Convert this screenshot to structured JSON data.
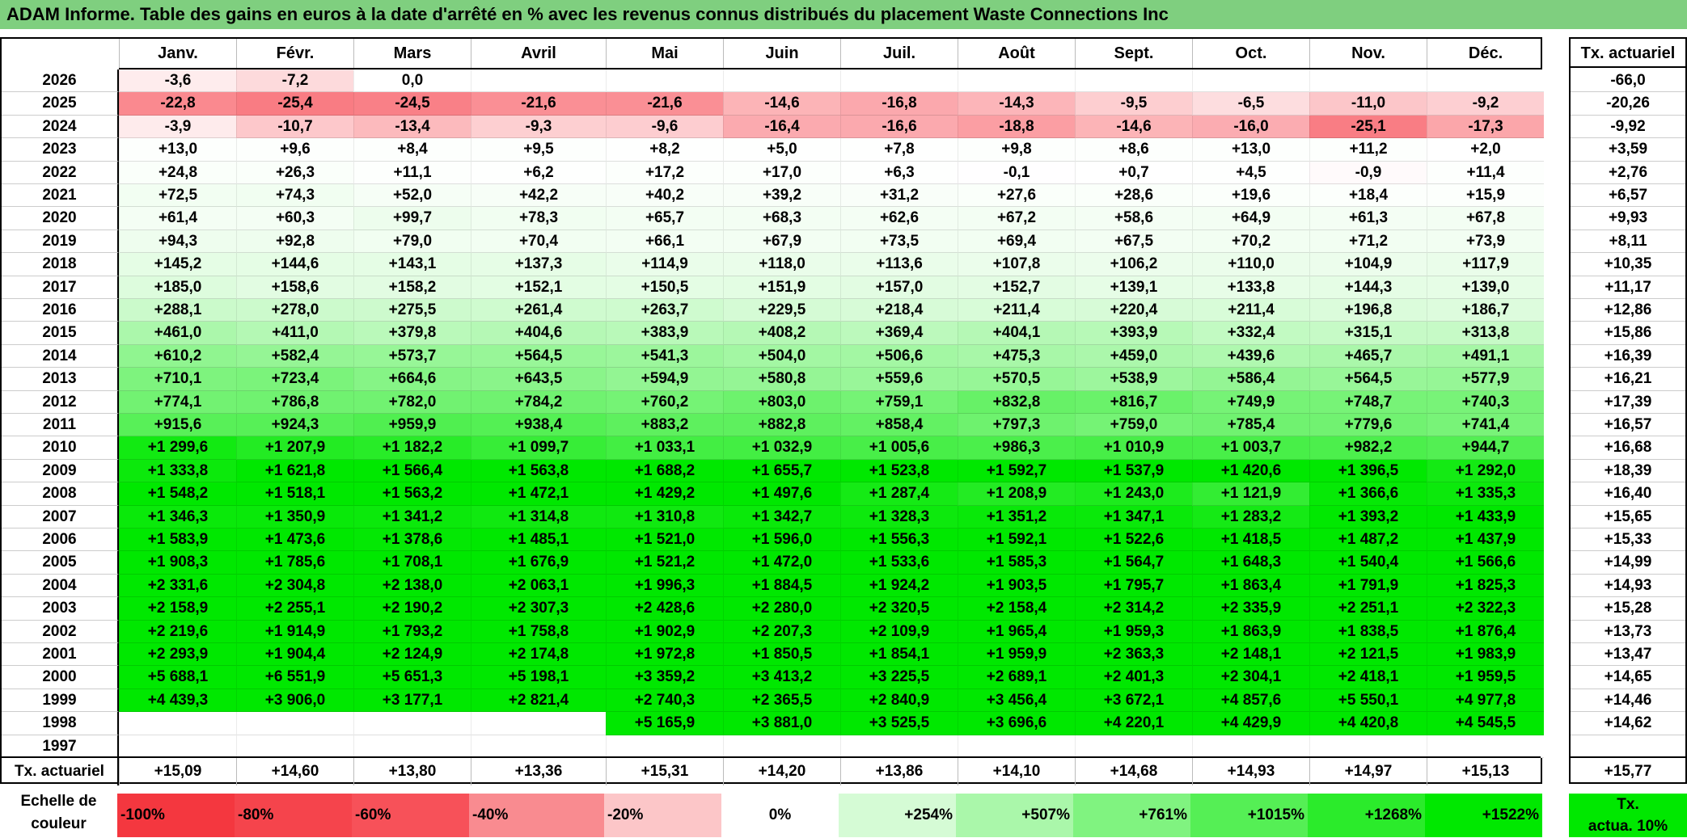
{
  "title": "ADAM Informe. Table des gains en euros à la date d'arrêté en % avec les revenus connus distribués du placement Waste Connections Inc",
  "months": [
    "Janv.",
    "Févr.",
    "Mars",
    "Avril",
    "Mai",
    "Juin",
    "Juil.",
    "Août",
    "Sept.",
    "Oct.",
    "Nov.",
    "Déc."
  ],
  "rows": [
    {
      "year": "2026",
      "values": [
        "-3,6",
        "-7,2",
        "0,0",
        "",
        "",
        "",
        "",
        "",
        "",
        "",
        "",
        ""
      ],
      "tx": "-66,0"
    },
    {
      "year": "2025",
      "values": [
        "-22,8",
        "-25,4",
        "-24,5",
        "-21,6",
        "-21,6",
        "-14,6",
        "-16,8",
        "-14,3",
        "-9,5",
        "-6,5",
        "-11,0",
        "-9,2"
      ],
      "tx": "-20,26"
    },
    {
      "year": "2024",
      "values": [
        "-3,9",
        "-10,7",
        "-13,4",
        "-9,3",
        "-9,6",
        "-16,4",
        "-16,6",
        "-18,8",
        "-14,6",
        "-16,0",
        "-25,1",
        "-17,3"
      ],
      "tx": "-9,92"
    },
    {
      "year": "2023",
      "values": [
        "+13,0",
        "+9,6",
        "+8,4",
        "+9,5",
        "+8,2",
        "+5,0",
        "+7,8",
        "+9,8",
        "+8,6",
        "+13,0",
        "+11,2",
        "+2,0"
      ],
      "tx": "+3,59"
    },
    {
      "year": "2022",
      "values": [
        "+24,8",
        "+26,3",
        "+11,1",
        "+6,2",
        "+17,2",
        "+17,0",
        "+6,3",
        "-0,1",
        "+0,7",
        "+4,5",
        "-0,9",
        "+11,4"
      ],
      "tx": "+2,76"
    },
    {
      "year": "2021",
      "values": [
        "+72,5",
        "+74,3",
        "+52,0",
        "+42,2",
        "+40,2",
        "+39,2",
        "+31,2",
        "+27,6",
        "+28,6",
        "+19,6",
        "+18,4",
        "+15,9"
      ],
      "tx": "+6,57"
    },
    {
      "year": "2020",
      "values": [
        "+61,4",
        "+60,3",
        "+99,7",
        "+78,3",
        "+65,7",
        "+68,3",
        "+62,6",
        "+67,2",
        "+58,6",
        "+64,9",
        "+61,3",
        "+67,8"
      ],
      "tx": "+9,93"
    },
    {
      "year": "2019",
      "values": [
        "+94,3",
        "+92,8",
        "+79,0",
        "+70,4",
        "+66,1",
        "+67,9",
        "+73,5",
        "+69,4",
        "+67,5",
        "+70,2",
        "+71,2",
        "+73,9"
      ],
      "tx": "+8,11"
    },
    {
      "year": "2018",
      "values": [
        "+145,2",
        "+144,6",
        "+143,1",
        "+137,3",
        "+114,9",
        "+118,0",
        "+113,6",
        "+107,8",
        "+106,2",
        "+110,0",
        "+104,9",
        "+117,9"
      ],
      "tx": "+10,35"
    },
    {
      "year": "2017",
      "values": [
        "+185,0",
        "+158,6",
        "+158,2",
        "+152,1",
        "+150,5",
        "+151,9",
        "+157,0",
        "+152,7",
        "+139,1",
        "+133,8",
        "+144,3",
        "+139,0"
      ],
      "tx": "+11,17"
    },
    {
      "year": "2016",
      "values": [
        "+288,1",
        "+278,0",
        "+275,5",
        "+261,4",
        "+263,7",
        "+229,5",
        "+218,4",
        "+211,4",
        "+220,4",
        "+211,4",
        "+196,8",
        "+186,7"
      ],
      "tx": "+12,86"
    },
    {
      "year": "2015",
      "values": [
        "+461,0",
        "+411,0",
        "+379,8",
        "+404,6",
        "+383,9",
        "+408,2",
        "+369,4",
        "+404,1",
        "+393,9",
        "+332,4",
        "+315,1",
        "+313,8"
      ],
      "tx": "+15,86"
    },
    {
      "year": "2014",
      "values": [
        "+610,2",
        "+582,4",
        "+573,7",
        "+564,5",
        "+541,3",
        "+504,0",
        "+506,6",
        "+475,3",
        "+459,0",
        "+439,6",
        "+465,7",
        "+491,1"
      ],
      "tx": "+16,39"
    },
    {
      "year": "2013",
      "values": [
        "+710,1",
        "+723,4",
        "+664,6",
        "+643,5",
        "+594,9",
        "+580,8",
        "+559,6",
        "+570,5",
        "+538,9",
        "+586,4",
        "+564,5",
        "+577,9"
      ],
      "tx": "+16,21"
    },
    {
      "year": "2012",
      "values": [
        "+774,1",
        "+786,8",
        "+782,0",
        "+784,2",
        "+760,2",
        "+803,0",
        "+759,1",
        "+832,8",
        "+816,7",
        "+749,9",
        "+748,7",
        "+740,3"
      ],
      "tx": "+17,39"
    },
    {
      "year": "2011",
      "values": [
        "+915,6",
        "+924,3",
        "+959,9",
        "+938,4",
        "+883,2",
        "+882,8",
        "+858,4",
        "+797,3",
        "+759,0",
        "+785,4",
        "+779,6",
        "+741,4"
      ],
      "tx": "+16,57"
    },
    {
      "year": "2010",
      "values": [
        "+1 299,6",
        "+1 207,9",
        "+1 182,2",
        "+1 099,7",
        "+1 033,1",
        "+1 032,9",
        "+1 005,6",
        "+986,3",
        "+1 010,9",
        "+1 003,7",
        "+982,2",
        "+944,7"
      ],
      "tx": "+16,68"
    },
    {
      "year": "2009",
      "values": [
        "+1 333,8",
        "+1 621,8",
        "+1 566,4",
        "+1 563,8",
        "+1 688,2",
        "+1 655,7",
        "+1 523,8",
        "+1 592,7",
        "+1 537,9",
        "+1 420,6",
        "+1 396,5",
        "+1 292,0"
      ],
      "tx": "+18,39"
    },
    {
      "year": "2008",
      "values": [
        "+1 548,2",
        "+1 518,1",
        "+1 563,2",
        "+1 472,1",
        "+1 429,2",
        "+1 497,6",
        "+1 287,4",
        "+1 208,9",
        "+1 243,0",
        "+1 121,9",
        "+1 366,6",
        "+1 335,3"
      ],
      "tx": "+16,40"
    },
    {
      "year": "2007",
      "values": [
        "+1 346,3",
        "+1 350,9",
        "+1 341,2",
        "+1 314,8",
        "+1 310,8",
        "+1 342,7",
        "+1 328,3",
        "+1 351,2",
        "+1 347,1",
        "+1 283,2",
        "+1 393,2",
        "+1 433,9"
      ],
      "tx": "+15,65"
    },
    {
      "year": "2006",
      "values": [
        "+1 583,9",
        "+1 473,6",
        "+1 378,6",
        "+1 485,1",
        "+1 521,0",
        "+1 596,0",
        "+1 556,3",
        "+1 592,1",
        "+1 522,6",
        "+1 418,5",
        "+1 487,2",
        "+1 437,9"
      ],
      "tx": "+15,33"
    },
    {
      "year": "2005",
      "values": [
        "+1 908,3",
        "+1 785,6",
        "+1 708,1",
        "+1 676,9",
        "+1 521,2",
        "+1 472,0",
        "+1 533,6",
        "+1 585,3",
        "+1 564,7",
        "+1 648,3",
        "+1 540,4",
        "+1 566,6"
      ],
      "tx": "+14,99"
    },
    {
      "year": "2004",
      "values": [
        "+2 331,6",
        "+2 304,8",
        "+2 138,0",
        "+2 063,1",
        "+1 996,3",
        "+1 884,5",
        "+1 924,2",
        "+1 903,5",
        "+1 795,7",
        "+1 863,4",
        "+1 791,9",
        "+1 825,3"
      ],
      "tx": "+14,93"
    },
    {
      "year": "2003",
      "values": [
        "+2 158,9",
        "+2 255,1",
        "+2 190,2",
        "+2 307,3",
        "+2 428,6",
        "+2 280,0",
        "+2 320,5",
        "+2 158,4",
        "+2 314,2",
        "+2 335,9",
        "+2 251,1",
        "+2 322,3"
      ],
      "tx": "+15,28"
    },
    {
      "year": "2002",
      "values": [
        "+2 219,6",
        "+1 914,9",
        "+1 793,2",
        "+1 758,8",
        "+1 902,9",
        "+2 207,3",
        "+2 109,9",
        "+1 965,4",
        "+1 959,3",
        "+1 863,9",
        "+1 838,5",
        "+1 876,4"
      ],
      "tx": "+13,73"
    },
    {
      "year": "2001",
      "values": [
        "+2 293,9",
        "+1 904,4",
        "+2 124,9",
        "+2 174,8",
        "+1 972,8",
        "+1 850,5",
        "+1 854,1",
        "+1 959,9",
        "+2 363,3",
        "+2 148,1",
        "+2 121,5",
        "+1 983,9"
      ],
      "tx": "+13,47"
    },
    {
      "year": "2000",
      "values": [
        "+5 688,1",
        "+6 551,9",
        "+5 651,3",
        "+5 198,1",
        "+3 359,2",
        "+3 413,2",
        "+3 225,5",
        "+2 689,1",
        "+2 401,3",
        "+2 304,1",
        "+2 418,1",
        "+1 959,5"
      ],
      "tx": "+14,65"
    },
    {
      "year": "1999",
      "values": [
        "+4 439,3",
        "+3 906,0",
        "+3 177,1",
        "+2 821,4",
        "+2 740,3",
        "+2 365,5",
        "+2 840,9",
        "+3 456,4",
        "+3 672,1",
        "+4 857,6",
        "+5 550,1",
        "+4 977,8"
      ],
      "tx": "+14,46"
    },
    {
      "year": "1998",
      "values": [
        "",
        "",
        "",
        "",
        "+5 165,9",
        "+3 881,0",
        "+3 525,5",
        "+3 696,6",
        "+4 220,1",
        "+4 429,9",
        "+4 420,8",
        "+4 545,5"
      ],
      "tx": "+14,62"
    },
    {
      "year": "1997",
      "values": [
        "",
        "",
        "",
        "",
        "",
        "",
        "",
        "",
        "",
        "",
        "",
        ""
      ],
      "tx": ""
    }
  ],
  "footer": {
    "label": "Tx. actuariel",
    "values": [
      "+15,09",
      "+14,60",
      "+13,80",
      "+13,36",
      "+15,31",
      "+14,20",
      "+13,86",
      "+14,10",
      "+14,68",
      "+14,93",
      "+14,97",
      "+15,13"
    ],
    "total": "+15,77"
  },
  "tx_header": "Tx. actuariel",
  "scale": {
    "label_line1": "Echelle de",
    "label_line2": "couleur",
    "swatches": [
      {
        "text": "-100%",
        "color": "#f4373f",
        "align": "left"
      },
      {
        "text": "-80%",
        "color": "#f5444c",
        "align": "left"
      },
      {
        "text": "-60%",
        "color": "#f75159",
        "align": "left"
      },
      {
        "text": "-40%",
        "color": "#f98b90",
        "align": "left"
      },
      {
        "text": "-20%",
        "color": "#fcc6c8",
        "align": "left"
      },
      {
        "text": "0%",
        "color": "#ffffff",
        "align": "center"
      },
      {
        "text": "+254%",
        "color": "#d5fbd5",
        "align": "right"
      },
      {
        "text": "+507%",
        "color": "#aaf7aa",
        "align": "right"
      },
      {
        "text": "+761%",
        "color": "#80f380",
        "align": "right"
      },
      {
        "text": "+1015%",
        "color": "#55ef55",
        "align": "right"
      },
      {
        "text": "+1268%",
        "color": "#2beb2b",
        "align": "right"
      },
      {
        "text": "+1522%",
        "color": "#00e800",
        "align": "right"
      }
    ],
    "tx_legend_line1": "Tx.",
    "tx_legend_line2": "actua. 10%"
  },
  "colors": {
    "title_bg": "#7fcf7f",
    "max_green": "#00e800",
    "max_red": "#f4373f"
  }
}
